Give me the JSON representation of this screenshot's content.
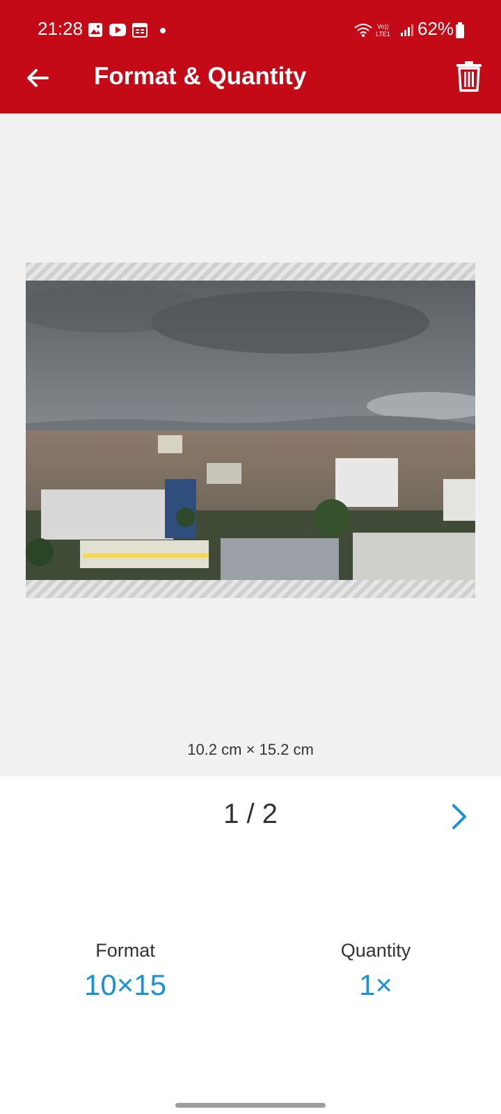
{
  "status_bar": {
    "time": "21:28",
    "battery": "62%",
    "icons": [
      "gallery-icon",
      "youtube-icon",
      "calendar-icon",
      "wifi-icon",
      "volte-icon",
      "signal-icon",
      "battery-icon"
    ]
  },
  "toolbar": {
    "title": "Format & Quantity",
    "back_icon": "arrow-left-icon",
    "delete_icon": "trash-icon"
  },
  "preview": {
    "size_label": "10.2 cm × 15.2 cm"
  },
  "pager": {
    "page": "1 / 2",
    "next_icon": "chevron-right-icon"
  },
  "options": {
    "format_label": "Format",
    "format_value": "10×15",
    "quantity_label": "Quantity",
    "quantity_value": "1×"
  },
  "colors": {
    "appbar": "#c30a16",
    "accent": "#1a91d6",
    "preview_bg": "#f1f1f1"
  }
}
